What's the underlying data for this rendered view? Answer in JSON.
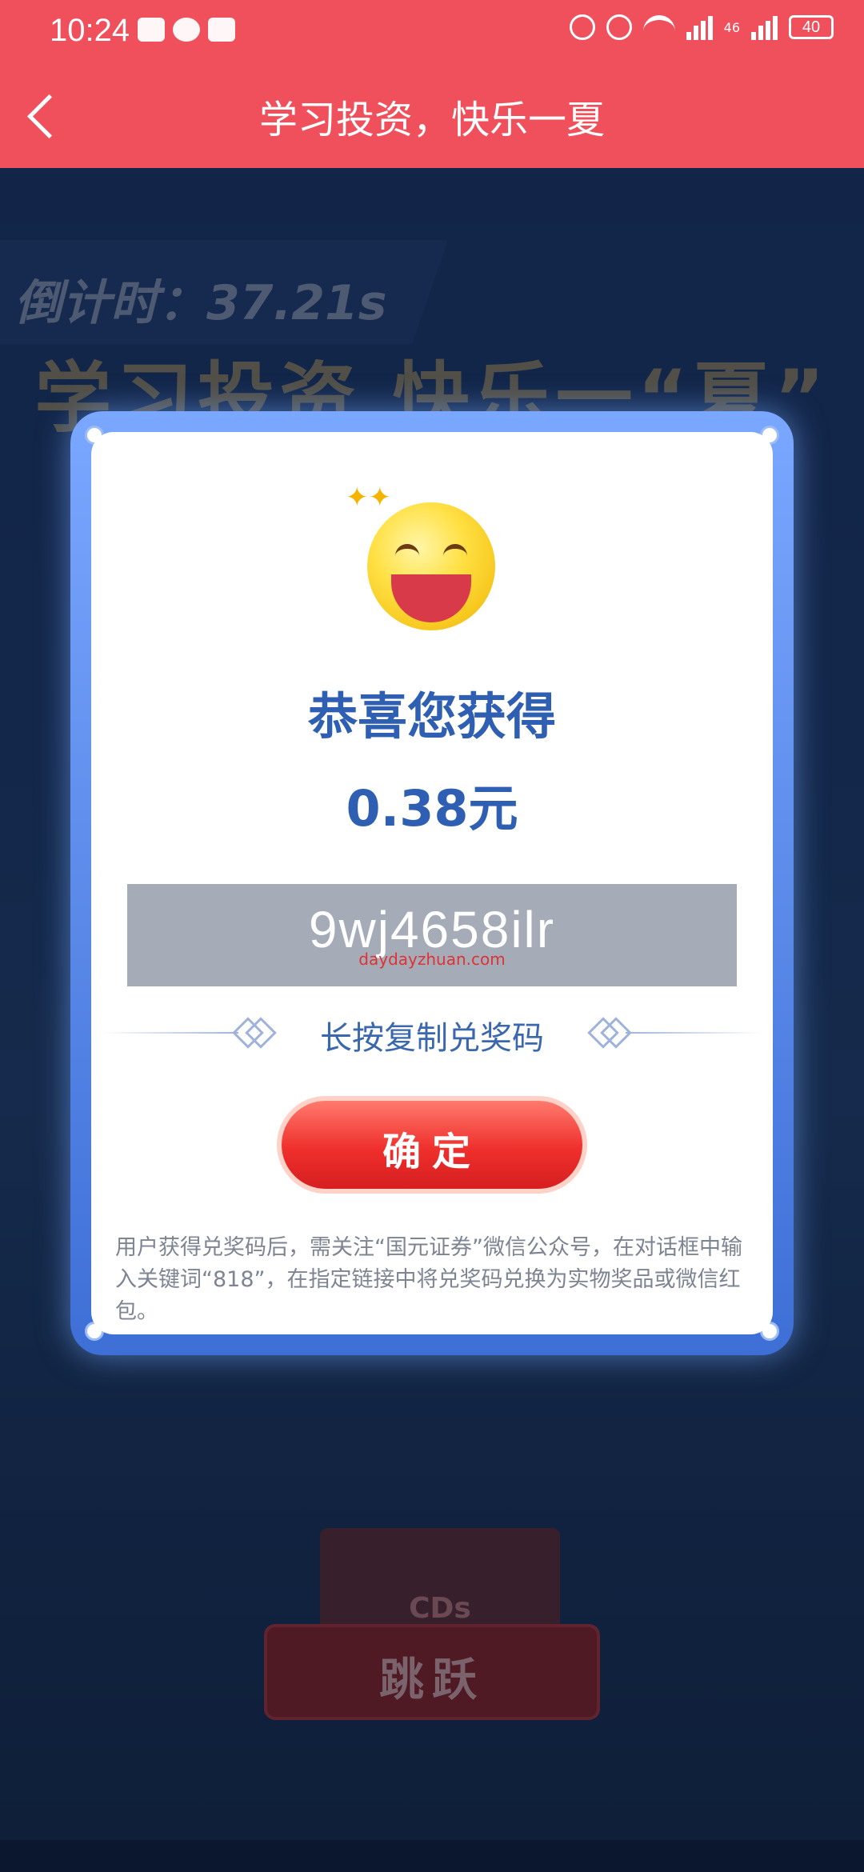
{
  "status_bar": {
    "time": "10:24",
    "network": "46",
    "battery": "40"
  },
  "header": {
    "title": "学习投资，快乐一夏"
  },
  "background": {
    "countdown": "倒计时：37.21s",
    "banner": "学习投资 快乐一“夏”",
    "podium_label": "CDs",
    "jump_label": "跳跃"
  },
  "modal": {
    "congrats": "恭喜您获得",
    "amount": "0.38元",
    "code": "9wj4658ilr",
    "code_watermark": "daydayzhuan.com",
    "copy_hint": "长按复制兑奖码",
    "confirm_label": "确定",
    "note": "用户获得兑奖码后，需关注“国元证券”微信公众号，在对话框中输入关键词“818”，在指定链接中将兑奖码兑换为实物奖品或微信红包。"
  },
  "colors": {
    "header_bg": "#f0505c",
    "accent_blue": "#2f5fb2",
    "button_red": "#ef2f2c"
  }
}
